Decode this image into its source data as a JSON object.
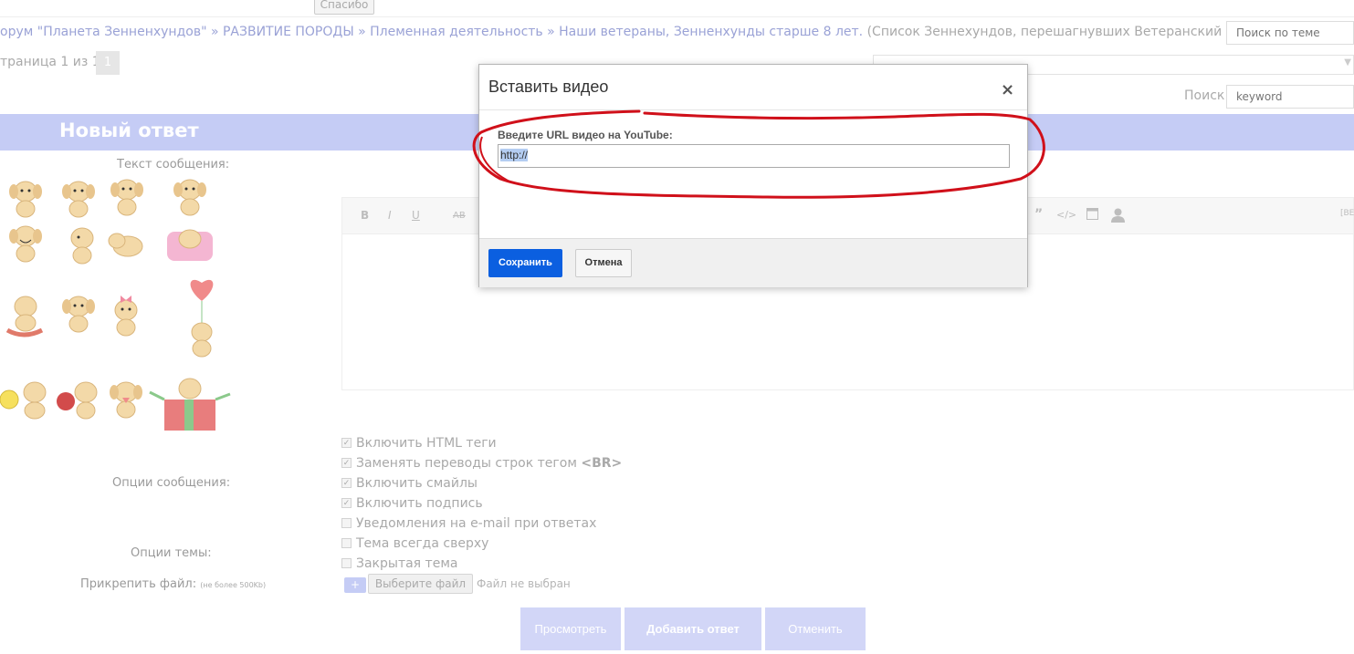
{
  "header": {
    "thanks_button": "Спасибо",
    "breadcrumb": {
      "forum": "орум \"Планета Зенненхундов\"",
      "sep": " » ",
      "section": "РАЗВИТИЕ ПОРОДЫ",
      "subsection": "Племенная деятельность",
      "topic": "Наши ветераны, Зенненхунды старше 8 лет.",
      "topic_note": " (Список Зеннехундов, перешагнувших Ветеранский порог .)"
    },
    "topic_search_placeholder": "Поиск по теме",
    "pager_text": "траница 1 из 1",
    "pager_current": "1",
    "search_label": "Поиск:",
    "search_placeholder": "keyword"
  },
  "reply": {
    "title": "Новый ответ",
    "message_label": "Текст сообщения:",
    "toolbar": {
      "bold": "B",
      "italic": "I",
      "underline": "U",
      "strike": "AB",
      "quote": "”",
      "code": "</>",
      "right_label": "[BE"
    }
  },
  "options": {
    "message_options_label": "Опции сообщения:",
    "topic_options_label": "Опции темы:",
    "attach_label": "Прикрепить файл:",
    "attach_note": "(не более 500Kb)",
    "items": [
      {
        "label": "Включить HTML теги",
        "checked": true
      },
      {
        "label": "Заменять переводы строк тегом ",
        "tag": "<BR>",
        "checked": true
      },
      {
        "label": "Включить смайлы",
        "checked": true
      },
      {
        "label": "Включить подпись",
        "checked": true
      },
      {
        "label": "Уведомления на e-mail при ответах",
        "checked": false
      },
      {
        "label": "Тема всегда сверху",
        "checked": false
      },
      {
        "label": "Закрытая тема",
        "checked": false
      }
    ],
    "plus_button": "+",
    "choose_file_button": "Выберите файл",
    "file_status": "Файл не выбран"
  },
  "actions": {
    "preview": "Просмотреть",
    "submit": "Добавить ответ",
    "cancel": "Отменить"
  },
  "modal": {
    "title": "Вставить видео",
    "close_symbol": "×",
    "url_label": "Введите URL видео на YouTube:",
    "url_value": "http://",
    "save_button": "Сохранить",
    "cancel_button": "Отмена"
  },
  "colors": {
    "accent_bar": "#c5ccf5",
    "save_button": "#0b5fe0",
    "annotation_red": "#d0101a"
  }
}
